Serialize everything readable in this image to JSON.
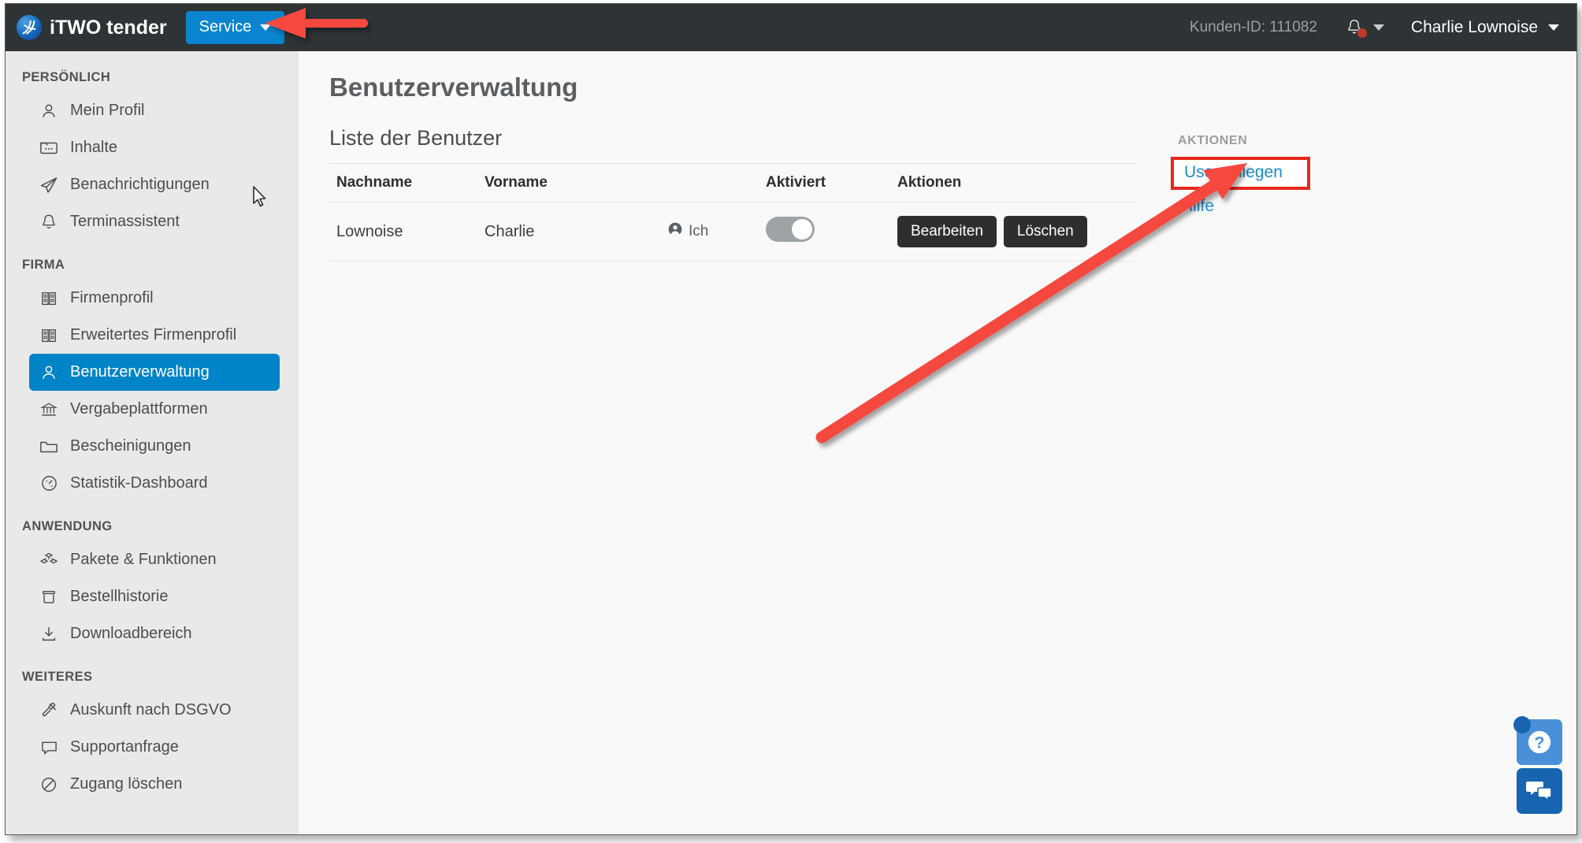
{
  "header": {
    "brand_title": "iTWO tender",
    "logo_icon": "itwo-logo-icon",
    "service_label": "Service",
    "customer_id": "Kunden-ID: 111082",
    "bell_icon": "bell-icon",
    "user_name": "Charlie Lownoise"
  },
  "sidebar": {
    "sections": [
      {
        "title": "PERSÖNLICH",
        "items": [
          {
            "label": "Mein Profil",
            "icon": "user-icon",
            "active": false
          },
          {
            "label": "Inhalte",
            "icon": "folder-dots-icon",
            "active": false
          },
          {
            "label": "Benachrichtigungen",
            "icon": "paper-plane-icon",
            "active": false
          },
          {
            "label": "Terminassistent",
            "icon": "bell-icon",
            "active": false
          }
        ]
      },
      {
        "title": "FIRMA",
        "items": [
          {
            "label": "Firmenprofil",
            "icon": "building-icon",
            "active": false
          },
          {
            "label": "Erweitertes Firmenprofil",
            "icon": "building-icon",
            "active": false
          },
          {
            "label": "Benutzerverwaltung",
            "icon": "user-icon",
            "active": true
          },
          {
            "label": "Vergabeplattformen",
            "icon": "bank-icon",
            "active": false
          },
          {
            "label": "Bescheinigungen",
            "icon": "folder-icon",
            "active": false
          },
          {
            "label": "Statistik-Dashboard",
            "icon": "gauge-icon",
            "active": false
          }
        ]
      },
      {
        "title": "ANWENDUNG",
        "items": [
          {
            "label": "Pakete & Funktionen",
            "icon": "boxes-icon",
            "active": false
          },
          {
            "label": "Bestellhistorie",
            "icon": "archive-icon",
            "active": false
          },
          {
            "label": "Downloadbereich",
            "icon": "download-icon",
            "active": false
          }
        ]
      },
      {
        "title": "WEITERES",
        "items": [
          {
            "label": "Auskunft nach DSGVO",
            "icon": "gavel-icon",
            "active": false
          },
          {
            "label": "Supportanfrage",
            "icon": "comment-icon",
            "active": false
          },
          {
            "label": "Zugang löschen",
            "icon": "ban-icon",
            "active": false
          }
        ]
      }
    ]
  },
  "main": {
    "page_title": "Benutzerverwaltung",
    "list_heading": "Liste der Benutzer",
    "table": {
      "columns": [
        "Nachname",
        "Vorname",
        "",
        "Aktiviert",
        "Aktionen"
      ],
      "rows": [
        {
          "nachname": "Lownoise",
          "vorname": "Charlie",
          "me_badge": "Ich",
          "me_icon": "user-circle-icon",
          "aktiviert": false,
          "edit_label": "Bearbeiten",
          "delete_label": "Löschen"
        }
      ]
    },
    "actions": {
      "title": "AKTIONEN",
      "create_user_label": "User anlegen",
      "help_label": "Hilfe"
    }
  },
  "floating": {
    "help_icon": "question-mark-icon",
    "chat_icon": "chat-bubbles-icon"
  },
  "colors": {
    "header_bg": "#2E3336",
    "accent_blue": "#0084C8",
    "service_blue": "#0984CE",
    "link_blue": "#1C8ACB",
    "sidebar_bg": "#E9E9E9",
    "main_bg": "#F9F9F9",
    "button_dark": "#2E2E2E",
    "annotation_red": "#E8271D",
    "badge_red": "#C0392B"
  },
  "annotations": {
    "header_arrow": "red-arrow-left",
    "actions_arrow": "red-arrow-diagonal",
    "highlight_box": "red-rectangle-create-user"
  }
}
